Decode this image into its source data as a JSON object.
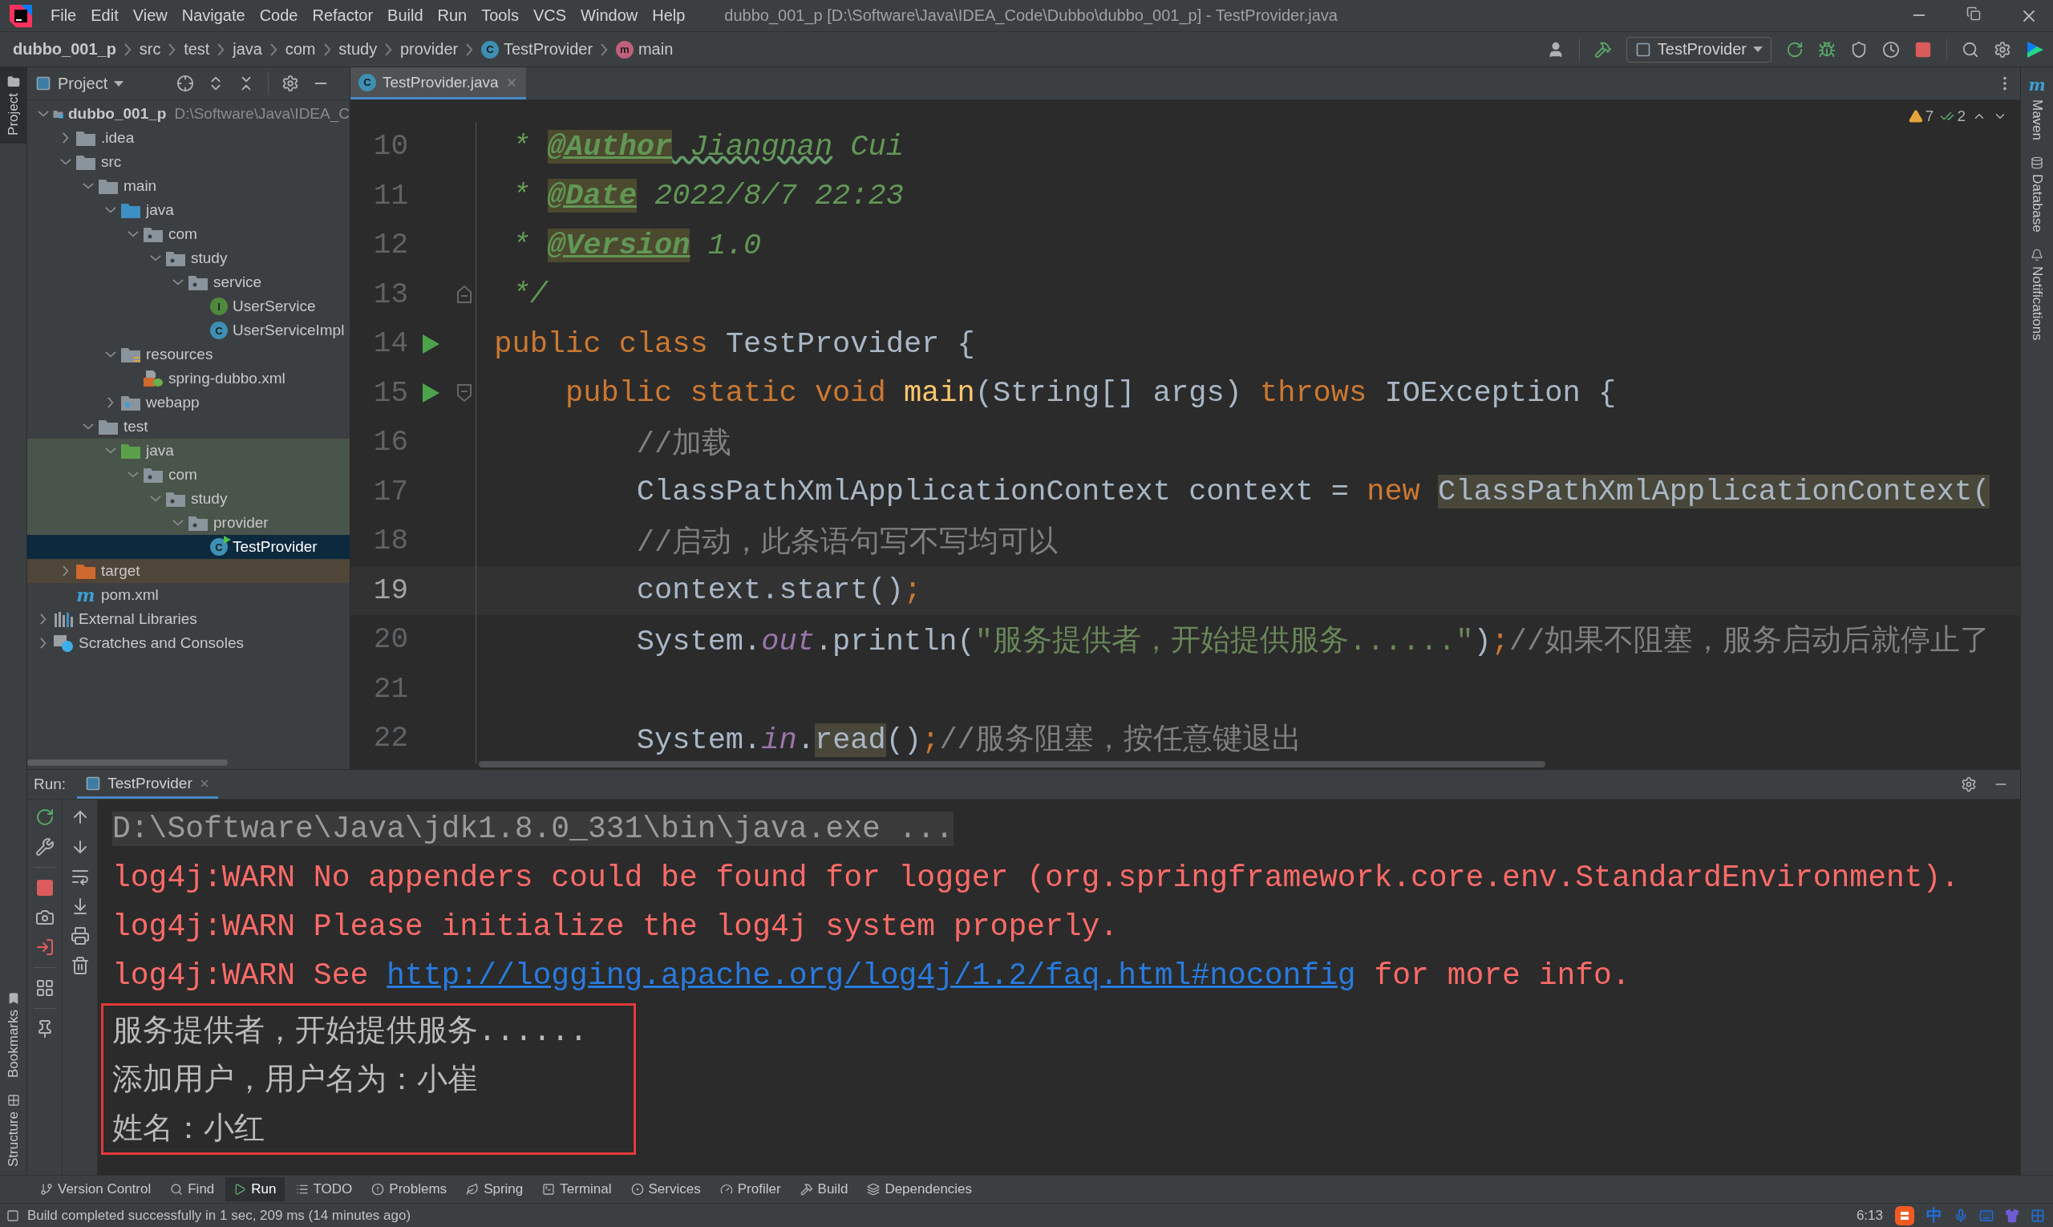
{
  "window": {
    "title": "dubbo_001_p [D:\\Software\\Java\\IDEA_Code\\Dubbo\\dubbo_001_p] - TestProvider.java"
  },
  "menu": [
    "File",
    "Edit",
    "View",
    "Navigate",
    "Code",
    "Refactor",
    "Build",
    "Run",
    "Tools",
    "VCS",
    "Window",
    "Help"
  ],
  "breadcrumbs": [
    {
      "label": "dubbo_001_p",
      "kind": "project"
    },
    {
      "label": "src",
      "kind": "folder"
    },
    {
      "label": "test",
      "kind": "folder"
    },
    {
      "label": "java",
      "kind": "folder"
    },
    {
      "label": "com",
      "kind": "folder"
    },
    {
      "label": "study",
      "kind": "folder"
    },
    {
      "label": "provider",
      "kind": "folder"
    },
    {
      "label": "TestProvider",
      "kind": "class",
      "glyph": "C"
    },
    {
      "label": "main",
      "kind": "method",
      "glyph": "m"
    }
  ],
  "run_config": {
    "label": "TestProvider"
  },
  "left_strip": {
    "top": [
      {
        "label": "Project",
        "selected": true
      }
    ],
    "bottom": [
      {
        "label": "Bookmarks",
        "selected": false
      },
      {
        "label": "Structure",
        "selected": false
      }
    ]
  },
  "project_panel": {
    "title": "Project",
    "tree": [
      {
        "label": "dubbo_001_p",
        "hint": "D:\\Software\\Java\\IDEA_C",
        "kind": "module",
        "expanded": true,
        "selected": false,
        "children": [
          {
            "label": ".idea",
            "kind": "folder",
            "expanded": false,
            "selected": false
          },
          {
            "label": "src",
            "kind": "folder",
            "expanded": true,
            "selected": false,
            "children": [
              {
                "label": "main",
                "kind": "folder",
                "expanded": true,
                "selected": false,
                "children": [
                  {
                    "label": "java",
                    "kind": "source-root",
                    "expanded": true,
                    "selected": false,
                    "children": [
                      {
                        "label": "com",
                        "kind": "package",
                        "expanded": true,
                        "selected": false,
                        "children": [
                          {
                            "label": "study",
                            "kind": "package",
                            "expanded": true,
                            "selected": false,
                            "children": [
                              {
                                "label": "service",
                                "kind": "package",
                                "expanded": true,
                                "selected": false,
                                "children": [
                                  {
                                    "label": "UserService",
                                    "kind": "interface",
                                    "glyph": "I",
                                    "selected": false
                                  },
                                  {
                                    "label": "UserServiceImpl",
                                    "kind": "class",
                                    "glyph": "C",
                                    "selected": false
                                  }
                                ]
                              }
                            ]
                          }
                        ]
                      }
                    ]
                  },
                  {
                    "label": "resources",
                    "kind": "resources-root",
                    "expanded": true,
                    "selected": false,
                    "children": [
                      {
                        "label": "spring-dubbo.xml",
                        "kind": "xml",
                        "selected": false
                      }
                    ]
                  },
                  {
                    "label": "webapp",
                    "kind": "web-folder",
                    "expanded": false,
                    "selected": false
                  }
                ]
              },
              {
                "label": "test",
                "kind": "folder",
                "expanded": true,
                "selected": false,
                "children": [
                  {
                    "label": "java",
                    "kind": "test-root",
                    "expanded": true,
                    "selected": false,
                    "in_test_sources": true,
                    "children": [
                      {
                        "label": "com",
                        "kind": "package",
                        "expanded": true,
                        "selected": false,
                        "in_test_sources": true,
                        "children": [
                          {
                            "label": "study",
                            "kind": "package",
                            "expanded": true,
                            "selected": false,
                            "in_test_sources": true,
                            "children": [
                              {
                                "label": "provider",
                                "kind": "package",
                                "expanded": true,
                                "selected": false,
                                "in_test_sources": true,
                                "children": [
                                  {
                                    "label": "TestProvider",
                                    "kind": "runnable-class",
                                    "glyph": "C",
                                    "selected": true
                                  }
                                ]
                              }
                            ]
                          }
                        ]
                      }
                    ]
                  }
                ]
              }
            ]
          },
          {
            "label": "target",
            "kind": "excluded-folder",
            "expanded": false,
            "selected": false,
            "excluded": true
          },
          {
            "label": "pom.xml",
            "kind": "maven",
            "glyph": "m",
            "selected": false
          }
        ]
      },
      {
        "label": "External Libraries",
        "kind": "libraries",
        "expanded": false,
        "selected": false
      },
      {
        "label": "Scratches and Consoles",
        "kind": "scratches",
        "expanded": false,
        "selected": false
      }
    ]
  },
  "editor": {
    "tabs": [
      {
        "label": "TestProvider.java",
        "glyph": "C",
        "selected": true
      }
    ],
    "inspections": {
      "warnings": "7",
      "weak_warnings": "2"
    },
    "lines": [
      {
        "number": "10",
        "current": false,
        "tokens": [
          {
            "kind": "doc",
            "text": " * "
          },
          {
            "kind": "doc-tag",
            "text": "@Author"
          },
          {
            "kind": "doc",
            "text": " Jiangnan",
            "typo": true
          },
          {
            "kind": "doc",
            "text": " Cui"
          }
        ]
      },
      {
        "number": "11",
        "current": false,
        "tokens": [
          {
            "kind": "doc",
            "text": " * "
          },
          {
            "kind": "doc-tag",
            "text": "@Date"
          },
          {
            "kind": "doc",
            "text": " 2022/8/7 22:23"
          }
        ]
      },
      {
        "number": "12",
        "current": false,
        "tokens": [
          {
            "kind": "doc",
            "text": " * "
          },
          {
            "kind": "doc-tag",
            "text": "@Version"
          },
          {
            "kind": "doc",
            "text": " 1.0"
          }
        ]
      },
      {
        "number": "13",
        "current": false,
        "fold_end": true,
        "tokens": [
          {
            "kind": "doc",
            "text": " */"
          }
        ]
      },
      {
        "number": "14",
        "current": false,
        "run_marker": true,
        "tokens": [
          {
            "kind": "keyword",
            "text": "public class "
          },
          {
            "kind": "plain",
            "text": "TestProvider {"
          }
        ]
      },
      {
        "number": "15",
        "current": false,
        "run_marker": true,
        "fold_start": true,
        "tokens": [
          {
            "kind": "keyword",
            "text": "    public static void "
          },
          {
            "kind": "method",
            "text": "main"
          },
          {
            "kind": "plain",
            "text": "(String[] args) "
          },
          {
            "kind": "keyword",
            "text": "throws "
          },
          {
            "kind": "plain",
            "text": "IOException {"
          }
        ]
      },
      {
        "number": "16",
        "current": false,
        "tokens": [
          {
            "kind": "comment",
            "text": "        //加载"
          }
        ]
      },
      {
        "number": "17",
        "current": false,
        "tokens": [
          {
            "kind": "plain",
            "text": "        ClassPathXmlApplicationContext context = "
          },
          {
            "kind": "keyword",
            "text": "new "
          },
          {
            "kind": "plain",
            "text": "ClassPathXmlApplicationContext(",
            "highlighted": true
          }
        ]
      },
      {
        "number": "18",
        "current": false,
        "tokens": [
          {
            "kind": "comment",
            "text": "        //启动，此条语句写不写均可以"
          }
        ]
      },
      {
        "number": "19",
        "current": true,
        "tokens": [
          {
            "kind": "plain",
            "text": "        context.start()"
          },
          {
            "kind": "keyword",
            "text": ";"
          }
        ]
      },
      {
        "number": "20",
        "current": false,
        "tokens": [
          {
            "kind": "plain",
            "text": "        System."
          },
          {
            "kind": "static",
            "text": "out"
          },
          {
            "kind": "plain",
            "text": ".println("
          },
          {
            "kind": "string",
            "text": "\"服务提供者，开始提供服务......\""
          },
          {
            "kind": "plain",
            "text": ")"
          },
          {
            "kind": "keyword",
            "text": ";"
          },
          {
            "kind": "comment",
            "text": "//如果不阻塞，服务启动后就停止了"
          }
        ]
      },
      {
        "number": "21",
        "current": false
      },
      {
        "number": "22",
        "current": false,
        "tokens": [
          {
            "kind": "plain",
            "text": "        System."
          },
          {
            "kind": "static",
            "text": "in"
          },
          {
            "kind": "plain",
            "text": "."
          },
          {
            "kind": "plain",
            "text": "read",
            "highlighted": true
          },
          {
            "kind": "plain",
            "text": "()"
          },
          {
            "kind": "keyword",
            "text": ";"
          },
          {
            "kind": "comment",
            "text": "//服务阻塞，按任意键退出"
          }
        ]
      }
    ]
  },
  "right_strip": [
    {
      "label": "Maven",
      "glyph": "m",
      "kind": "maven"
    },
    {
      "label": "Database",
      "kind": "database"
    },
    {
      "label": "Notifications",
      "kind": "notifications"
    }
  ],
  "run_panel": {
    "label": "Run:",
    "tabs": [
      {
        "label": "TestProvider",
        "selected": true
      }
    ],
    "console": [
      {
        "kind": "command",
        "segments": [
          {
            "text": "D:\\Software\\Java\\jdk1.8.0_331\\bin\\java.exe ..."
          }
        ]
      },
      {
        "kind": "error",
        "segments": [
          {
            "text": "log4j:WARN No appenders could be found for logger (org.springframework.core.env.StandardEnvironment)."
          }
        ]
      },
      {
        "kind": "error",
        "segments": [
          {
            "text": "log4j:WARN Please initialize the log4j system properly."
          }
        ]
      },
      {
        "kind": "error",
        "segments": [
          {
            "text": "log4j:WARN See "
          },
          {
            "text": "http://logging.apache.org/log4j/1.2/faq.html#noconfig",
            "link": true
          },
          {
            "text": " for more info."
          }
        ]
      }
    ],
    "annotated_output": [
      "服务提供者，开始提供服务......",
      "添加用户，用户名为：小崔",
      "姓名：小红"
    ]
  },
  "tool_windows": [
    {
      "label": "Version Control",
      "selected": false
    },
    {
      "label": "Find",
      "selected": false
    },
    {
      "label": "Run",
      "selected": true
    },
    {
      "label": "TODO",
      "selected": false
    },
    {
      "label": "Problems",
      "selected": false
    },
    {
      "label": "Spring",
      "selected": false
    },
    {
      "label": "Terminal",
      "selected": false
    },
    {
      "label": "Services",
      "selected": false
    },
    {
      "label": "Profiler",
      "selected": false
    },
    {
      "label": "Build",
      "selected": false
    },
    {
      "label": "Dependencies",
      "selected": false
    }
  ],
  "status_bar": {
    "message": "Build completed successfully in 1 sec, 209 ms (14 minutes ago)",
    "position": "6:13",
    "ime_mode": "中"
  }
}
